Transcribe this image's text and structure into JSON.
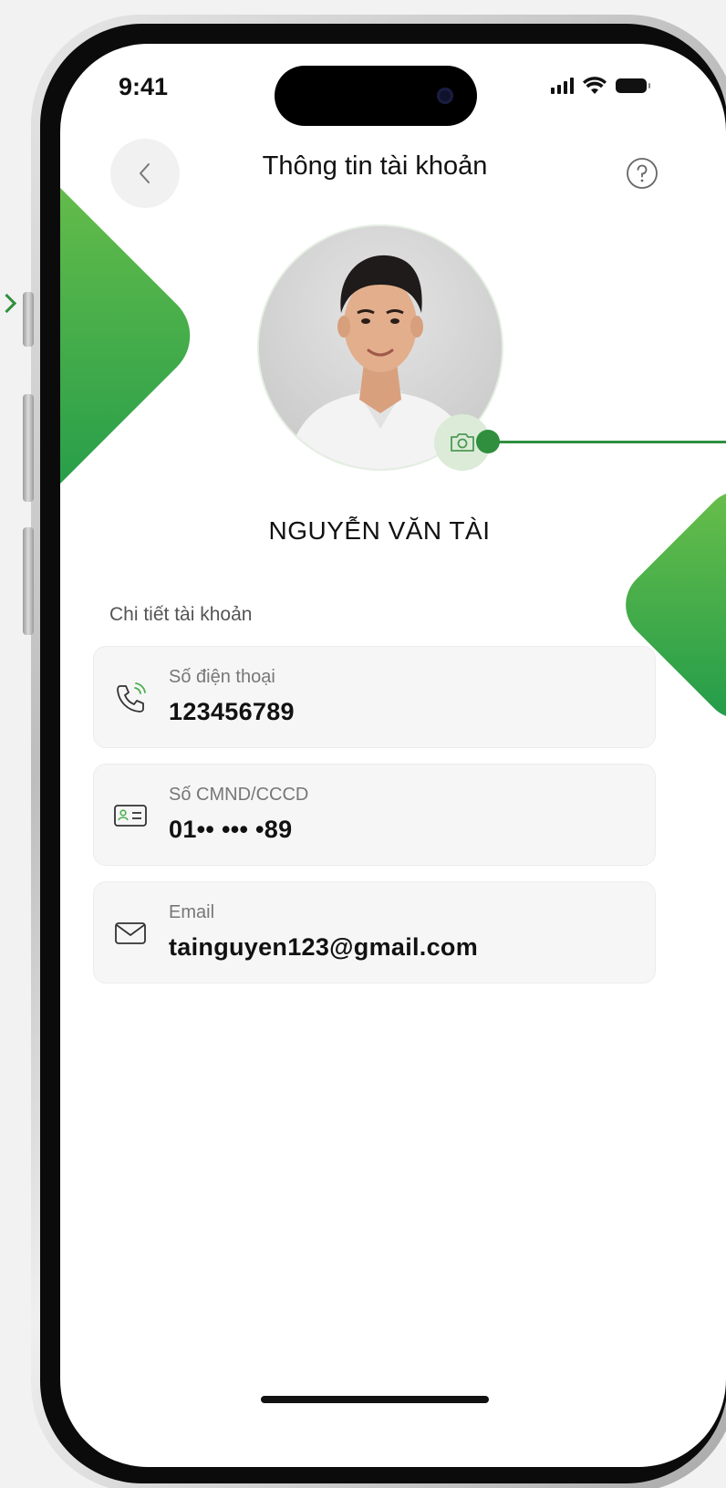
{
  "status_bar": {
    "time": "9:41",
    "icons": [
      "signal-icon",
      "wifi-icon",
      "battery-icon"
    ]
  },
  "header": {
    "title": "Thông tin tài khoản",
    "back_icon": "chevron-left-icon",
    "help_icon": "help-circle-icon"
  },
  "profile": {
    "name": "NGUYỄN VĂN TÀI",
    "camera_icon": "camera-icon"
  },
  "details": {
    "section_label": "Chi tiết tài khoản",
    "items": [
      {
        "icon": "phone-icon",
        "label": "Số điện thoại",
        "value": "123456789"
      },
      {
        "icon": "id-card-icon",
        "label": "Số CMND/CCCD",
        "value": "01•• ••• •89"
      },
      {
        "icon": "mail-icon",
        "label": "Email",
        "value": "tainguyen123@gmail.com"
      }
    ]
  },
  "colors": {
    "accent_green": "#2f8f3f",
    "deco_green_light": "#6cc04a",
    "deco_green_dark": "#1f9a4a",
    "card_bg": "#f6f6f6"
  }
}
